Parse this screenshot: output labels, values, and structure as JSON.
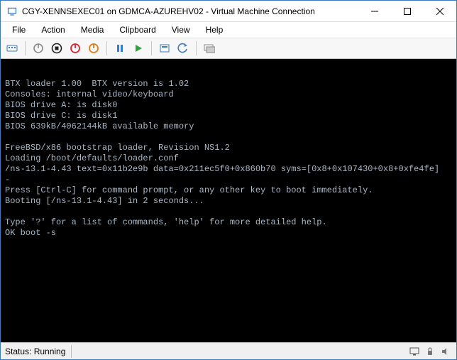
{
  "window": {
    "title": "CGY-XENNSEXEC01 on GDMCA-AZUREHV02 - Virtual Machine Connection"
  },
  "menu": {
    "items": [
      "File",
      "Action",
      "Media",
      "Clipboard",
      "View",
      "Help"
    ]
  },
  "toolbar": {
    "icons": [
      "ctrl-alt-del",
      "sep",
      "start-grey",
      "turnoff-black",
      "shutdown-red",
      "save-orange",
      "sep",
      "pause-blue",
      "reset-green",
      "sep",
      "checkpoint",
      "revert",
      "sep",
      "enhanced-session"
    ]
  },
  "console": {
    "lines": [
      "BTX loader 1.00  BTX version is 1.02",
      "Consoles: internal video/keyboard",
      "BIOS drive A: is disk0",
      "BIOS drive C: is disk1",
      "BIOS 639kB/4062144kB available memory",
      "",
      "FreeBSD/x86 bootstrap loader, Revision NS1.2",
      "Loading /boot/defaults/loader.conf",
      "/ns-13.1-4.43 text=0x11b2e9b data=0x211ec5f0+0x860b70 syms=[0x8+0x107430+0x8+0xfe4fe]",
      "-",
      "Press [Ctrl-C] for command prompt, or any other key to boot immediately.",
      "Booting [/ns-13.1-4.43] in 2 seconds...",
      "",
      "Type '?' for a list of commands, 'help' for more detailed help.",
      "OK boot -s"
    ]
  },
  "status": {
    "text": "Status: Running"
  }
}
